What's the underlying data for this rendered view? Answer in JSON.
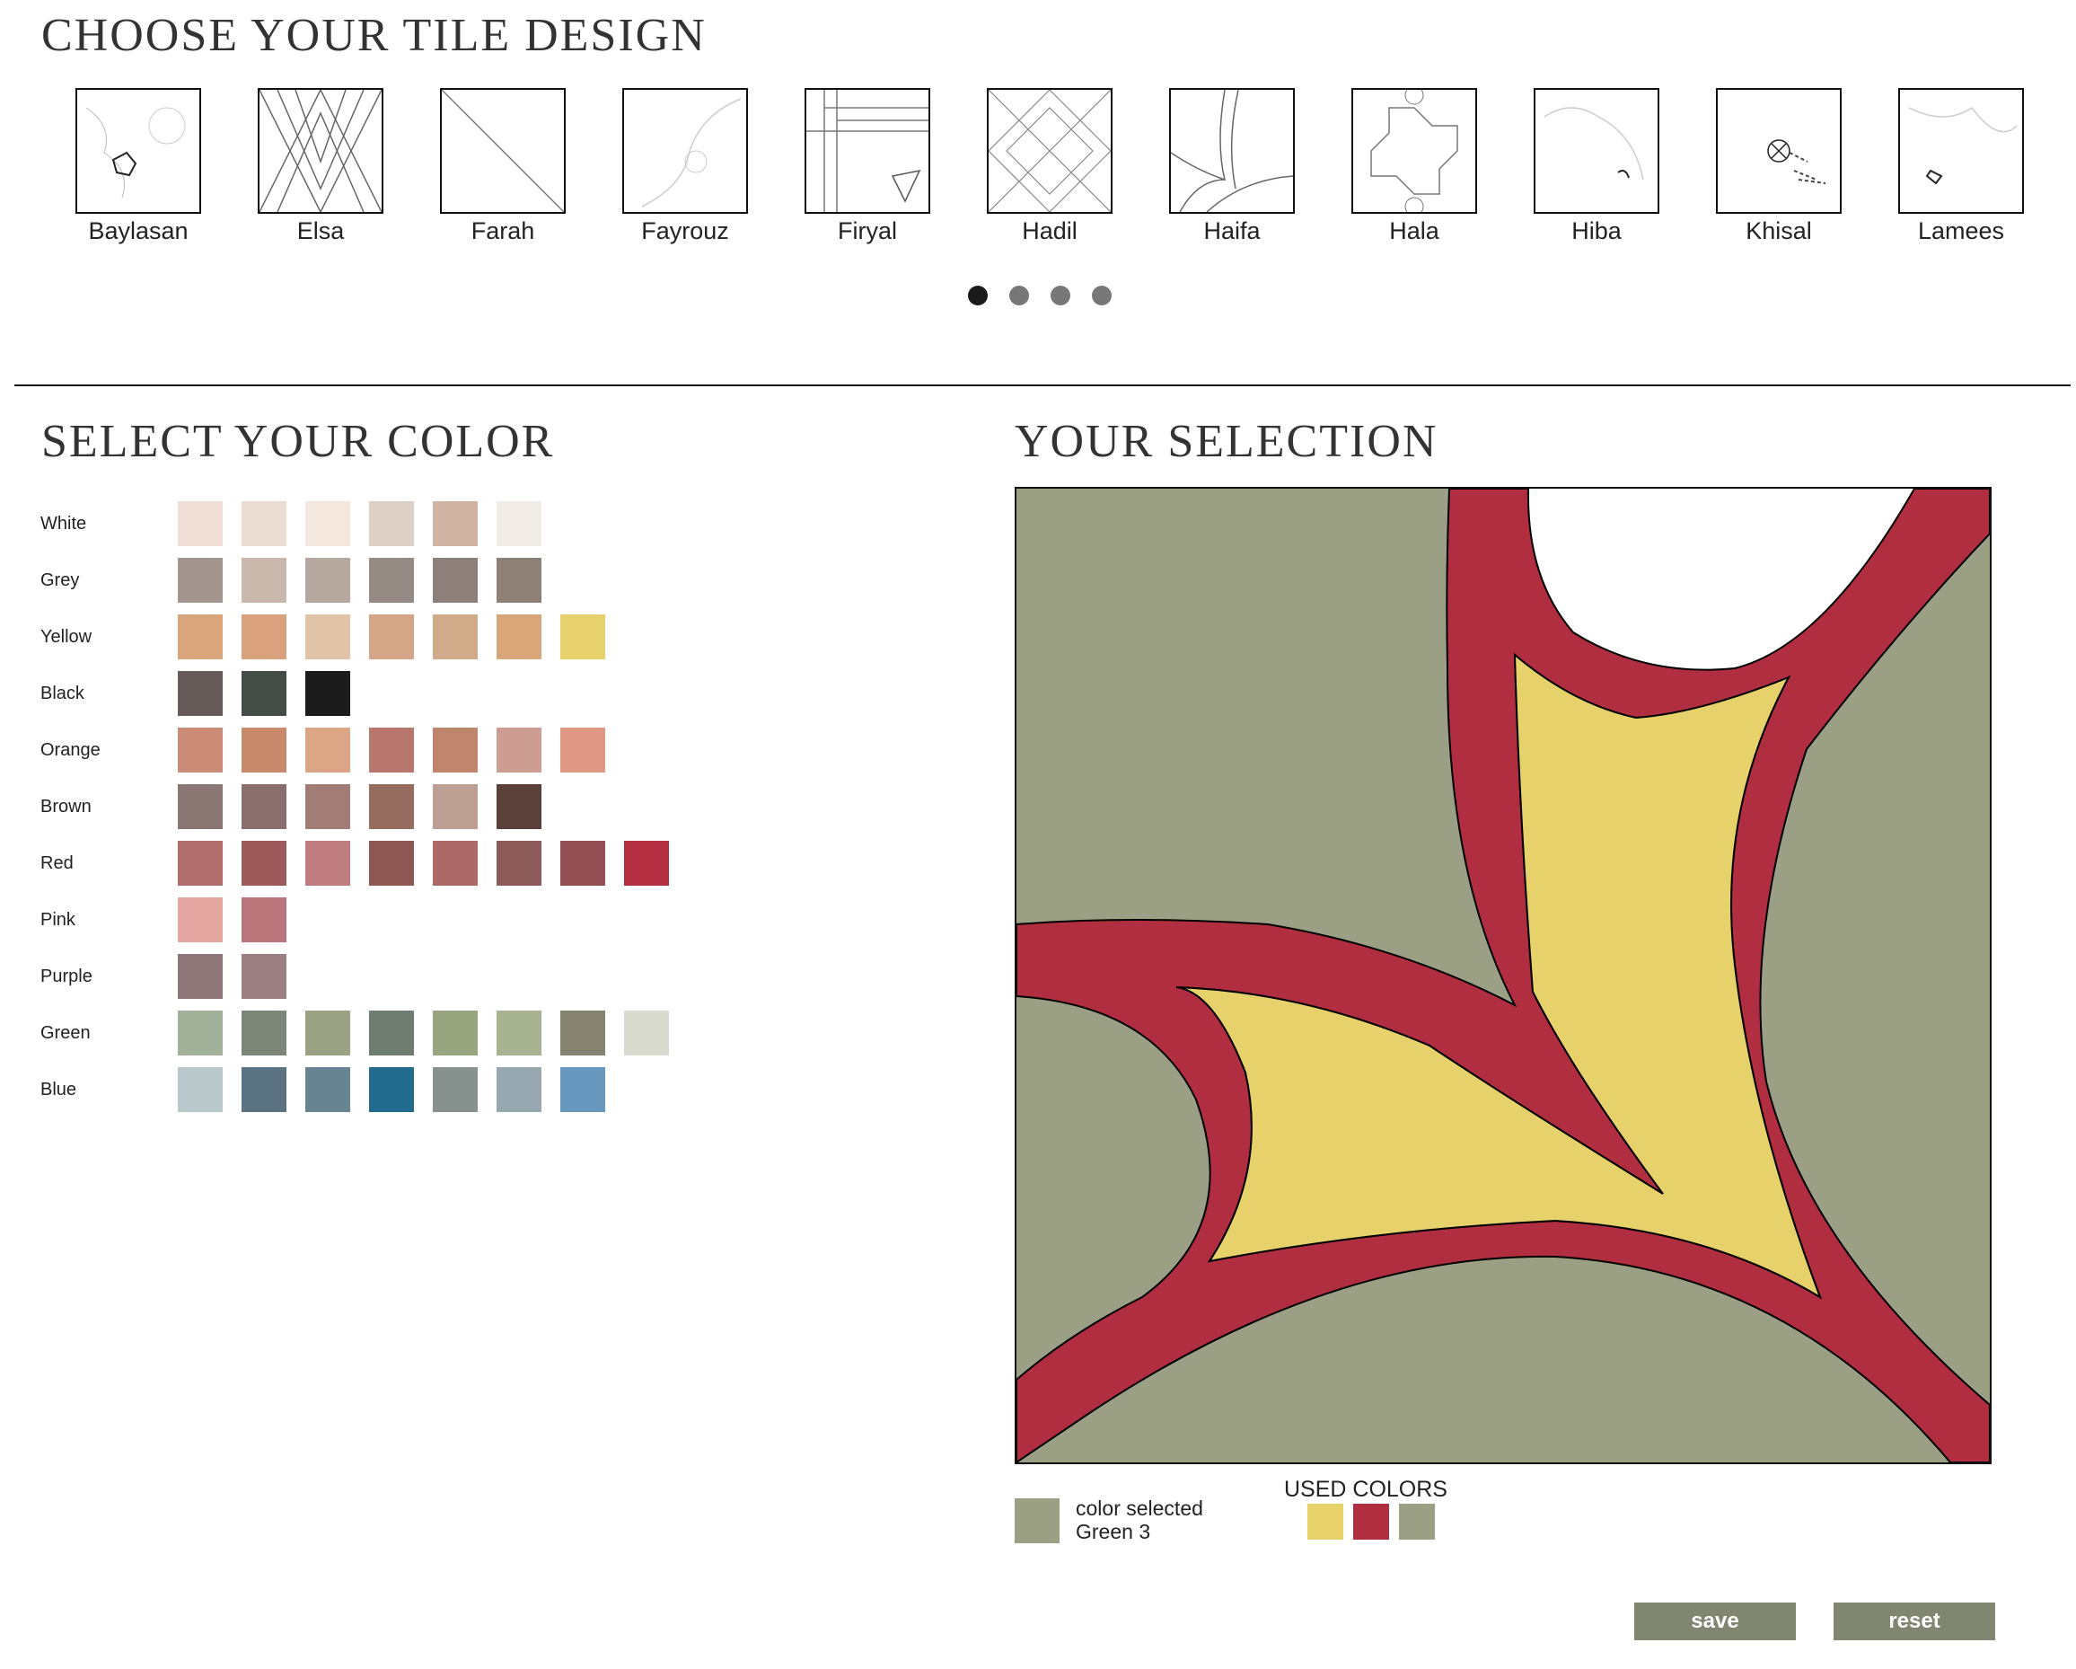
{
  "headings": {
    "tile_design": "CHOOSE YOUR TILE DESIGN",
    "color": "SELECT YOUR COLOR",
    "selection": "YOUR SELECTION"
  },
  "tiles": [
    {
      "name": "Baylasan"
    },
    {
      "name": "Elsa"
    },
    {
      "name": "Farah"
    },
    {
      "name": "Fayrouz"
    },
    {
      "name": "Firyal"
    },
    {
      "name": "Hadil"
    },
    {
      "name": "Haifa"
    },
    {
      "name": "Hala"
    },
    {
      "name": "Hiba"
    },
    {
      "name": "Khisal"
    },
    {
      "name": "Lamees"
    }
  ],
  "carousel": {
    "pages": 4,
    "active_page": 1
  },
  "palette": [
    {
      "label": "White",
      "colors": [
        "#efdfd7",
        "#ebdcd1",
        "#f3e7de",
        "#dcd0c4",
        "#cfb4a3",
        "#f2ece6"
      ]
    },
    {
      "label": "Grey",
      "colors": [
        "#a3958d",
        "#c9b8ab",
        "#b6a89f",
        "#968a84",
        "#8d807a",
        "#8e7f77"
      ]
    },
    {
      "label": "Yellow",
      "colors": [
        "#d9a57a",
        "#d9a27c",
        "#e1c3a8",
        "#d4a587",
        "#cfab8a",
        "#d9a679",
        "#e7d16c"
      ]
    },
    {
      "label": "Black",
      "colors": [
        "#665b59",
        "#434c45",
        "#1b1b1b"
      ]
    },
    {
      "label": "Orange",
      "colors": [
        "#cb8d77",
        "#c88a6b",
        "#dba586",
        "#b7776c",
        "#bf856d",
        "#cd9c93",
        "#e09985"
      ]
    },
    {
      "label": "Brown",
      "colors": [
        "#8b7773",
        "#8a6e6c",
        "#a17d76",
        "#966c5f",
        "#bd9f93",
        "#5b403a"
      ]
    },
    {
      "label": "Red",
      "colors": [
        "#b26e6c",
        "#9c5a5a",
        "#c07d81",
        "#8e5754",
        "#ad6967",
        "#8c5a58",
        "#914f54",
        "#b22e40"
      ]
    },
    {
      "label": "Pink",
      "colors": [
        "#e4a7a2",
        "#b9777b"
      ]
    },
    {
      "label": "Purple",
      "colors": [
        "#8f7678",
        "#9c7f80"
      ]
    },
    {
      "label": "Green",
      "colors": [
        "#a2b199",
        "#7c8678",
        "#9ba183",
        "#6e7d70",
        "#98a67f",
        "#a8b391",
        "#858270",
        "#d8dbcd"
      ]
    },
    {
      "label": "Blue",
      "colors": [
        "#b9c8ca",
        "#5b7283",
        "#678590",
        "#236b8d",
        "#87928f",
        "#97a8b0",
        "#6898be"
      ]
    }
  ],
  "preview": {
    "colors": {
      "background": "#9b9f84",
      "band": "#b12e40",
      "center": "#e6d16a",
      "corner": "#ffffff"
    }
  },
  "selected": {
    "label": "color selected",
    "name": "Green 3",
    "color": "#9b9f84"
  },
  "used_colors": {
    "title": "USED COLORS",
    "colors": [
      "#e6d16a",
      "#b12e40",
      "#9b9f84"
    ]
  },
  "buttons": {
    "save": "save",
    "reset": "reset"
  }
}
